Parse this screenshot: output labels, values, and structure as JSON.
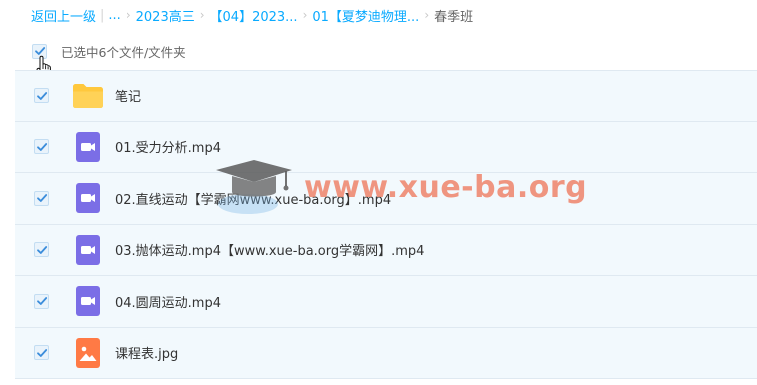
{
  "breadcrumb": {
    "back_label": "返回上一级",
    "ellipsis": "...",
    "items": [
      "2023高三",
      "【04】2023...",
      "01【夏梦迪物理...",
      "春季班"
    ]
  },
  "selection": {
    "label": "已选中6个文件/文件夹"
  },
  "files": [
    {
      "name": "笔记",
      "icon": "folder-icon",
      "type": "folder"
    },
    {
      "name": "01.受力分析.mp4",
      "icon": "video-file-icon",
      "type": "video"
    },
    {
      "name": "02.直线运动【学霸网www.xue-ba.org】.mp4",
      "icon": "video-file-icon",
      "type": "video"
    },
    {
      "name": "03.抛体运动.mp4【www.xue-ba.org学霸网】.mp4",
      "icon": "video-file-icon",
      "type": "video"
    },
    {
      "name": "04.圆周运动.mp4",
      "icon": "video-file-icon",
      "type": "video"
    },
    {
      "name": "课程表.jpg",
      "icon": "image-file-icon",
      "type": "image"
    }
  ],
  "watermark": {
    "text": "www.xue-ba.org"
  },
  "colors": {
    "link": "#09AAFF",
    "row_bg": "#f2f9fd",
    "checkbox_check": "#3b8ddb",
    "folder": "#FFC83D",
    "video": "#7B6EE6",
    "image": "#FF7A45",
    "watermark": "#EE785C"
  }
}
